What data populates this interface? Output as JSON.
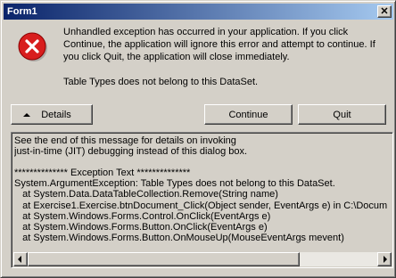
{
  "window": {
    "title": "Form1",
    "close_glyph": "✕"
  },
  "icons": {
    "error": "error-icon",
    "close": "close-icon",
    "details_arrow": "arrow-up-icon"
  },
  "message": {
    "line1": "Unhandled exception has occurred in your application. If you click Continue, the application will ignore this error and attempt to continue. If you click Quit, the application will close immediately.",
    "line2": "Table Types does not belong to this DataSet."
  },
  "buttons": {
    "details": "Details",
    "continue": "Continue",
    "quit": "Quit"
  },
  "details": {
    "text": "See the end of this message for details on invoking\njust-in-time (JIT) debugging instead of this dialog box.\n\n************** Exception Text **************\nSystem.ArgumentException: Table Types does not belong to this DataSet.\n   at System.Data.DataTableCollection.Remove(String name)\n   at Exercise1.Exercise.btnDocument_Click(Object sender, EventArgs e) in C:\\Docum\n   at System.Windows.Forms.Control.OnClick(EventArgs e)\n   at System.Windows.Forms.Button.OnClick(EventArgs e)\n   at System.Windows.Forms.Button.OnMouseUp(MouseEventArgs mevent)"
  },
  "colors": {
    "error_red": "#d81e1e",
    "title_start": "#0a246a",
    "title_end": "#a6caf0",
    "face": "#d4d0c8"
  }
}
